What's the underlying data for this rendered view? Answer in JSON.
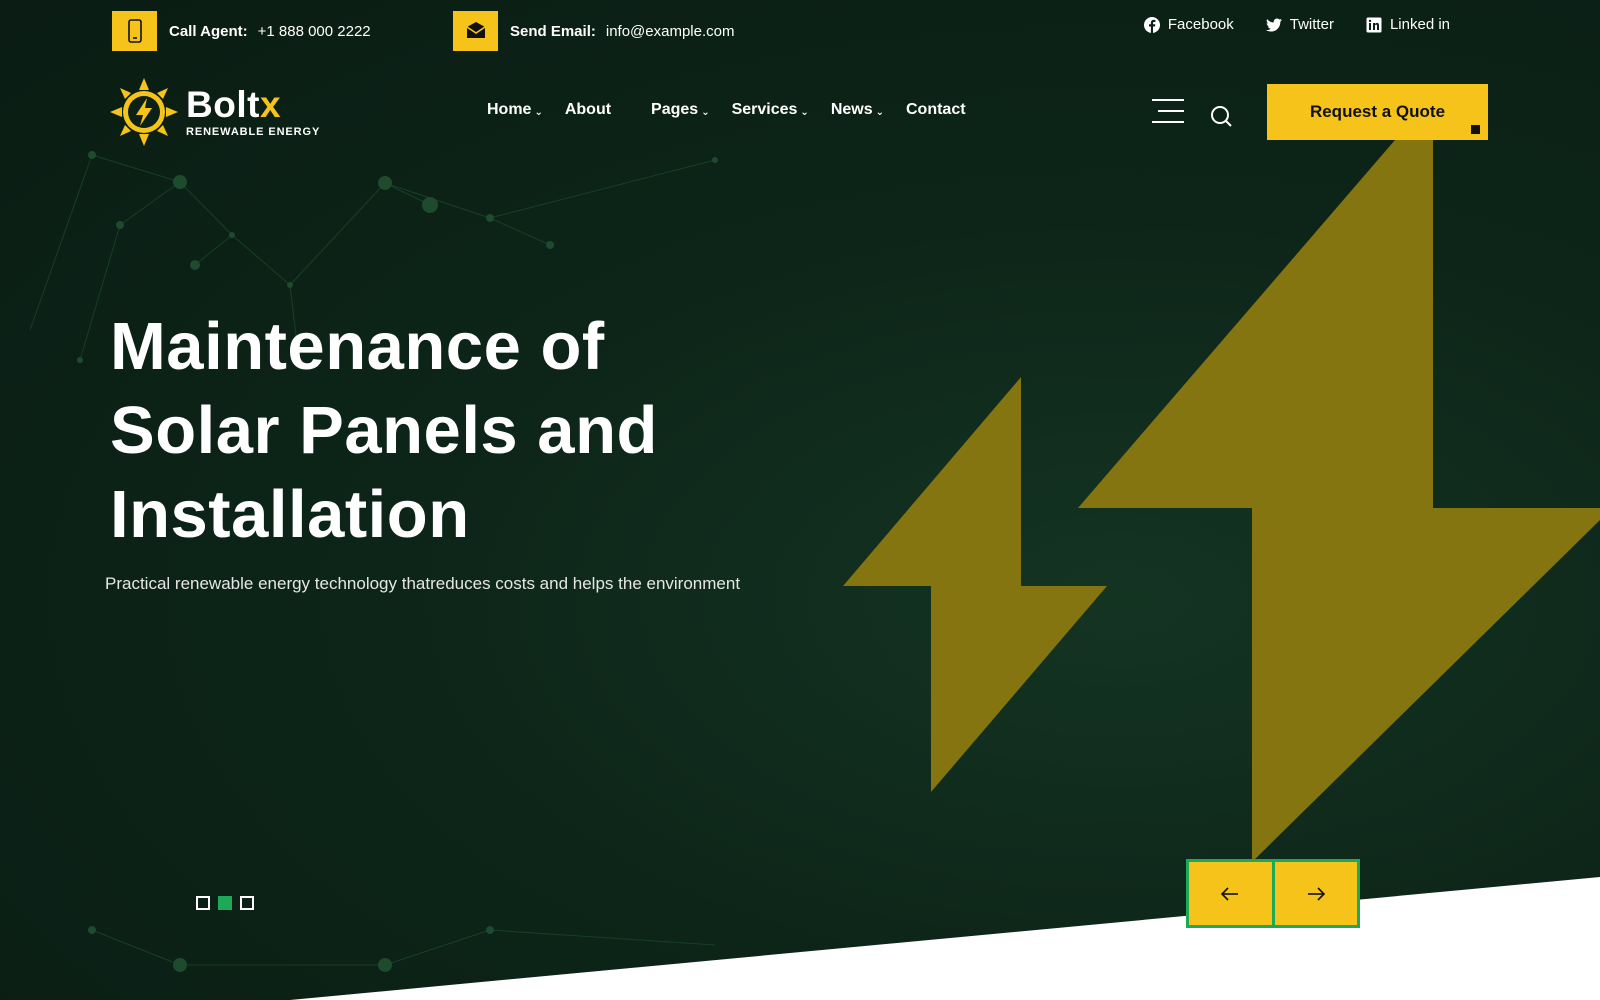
{
  "topbar": {
    "call_label": "Call Agent:",
    "call_value": "+1 888 000 2222",
    "email_label": "Send Email:",
    "email_value": "info@example.com",
    "socials": [
      {
        "label": "Facebook",
        "icon": "facebook-icon"
      },
      {
        "label": "Twitter",
        "icon": "twitter-icon"
      },
      {
        "label": "Linked in",
        "icon": "linkedin-icon"
      }
    ]
  },
  "brand": {
    "name_main": "Bolt",
    "name_accent": "x",
    "tagline": "RENEWABLE ENERGY"
  },
  "nav": {
    "items": [
      {
        "label": "Home",
        "has_dropdown": true
      },
      {
        "label": "About",
        "has_dropdown": false
      },
      {
        "label": "Pages",
        "has_dropdown": true
      },
      {
        "label": "Services",
        "has_dropdown": true
      },
      {
        "label": "News",
        "has_dropdown": true
      },
      {
        "label": "Contact",
        "has_dropdown": false
      }
    ],
    "quote_button": "Request a Quote"
  },
  "hero": {
    "title_line1": "Maintenance of",
    "title_line2": "Solar Panels and",
    "title_line3": "Installation",
    "subtitle": "Practical renewable energy technology thatreduces costs and helps the environment",
    "active_slide": 2,
    "slide_count": 3
  },
  "colors": {
    "accent": "#f5c31a",
    "green": "#1fa855",
    "background": "#0b2016",
    "bolt": "#857510"
  }
}
